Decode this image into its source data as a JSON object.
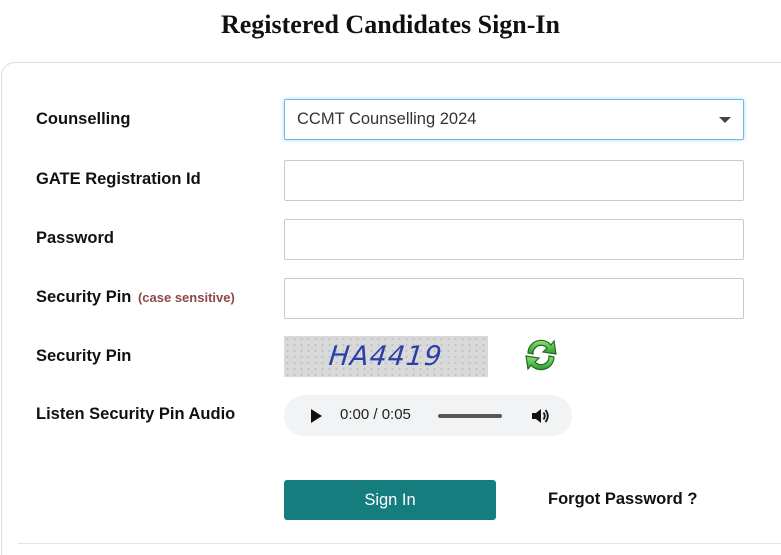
{
  "page": {
    "title": "Registered Candidates Sign-In"
  },
  "form": {
    "counselling": {
      "label": "Counselling",
      "selected": "CCMT Counselling 2024"
    },
    "registration": {
      "label": "GATE Registration Id",
      "value": ""
    },
    "password": {
      "label": "Password",
      "value": ""
    },
    "security_pin_input": {
      "label": "Security Pin",
      "note": "(case sensitive)",
      "value": ""
    },
    "security_pin_image": {
      "label": "Security Pin",
      "captcha_text": "HA4419"
    },
    "audio": {
      "label": "Listen Security Pin Audio",
      "time": "0:00 / 0:05"
    },
    "actions": {
      "signin_label": "Sign In",
      "forgot_label": "Forgot Password ?"
    }
  },
  "icons": {
    "refresh": "refresh-captcha-icon",
    "play": "play-icon",
    "volume": "volume-icon",
    "dropdown": "chevron-down-icon"
  },
  "colors": {
    "primary_button": "#167d7f",
    "captcha_text": "#2a3fa8",
    "note_text": "#8a4a4a",
    "focus_border": "#6bbbe0"
  }
}
